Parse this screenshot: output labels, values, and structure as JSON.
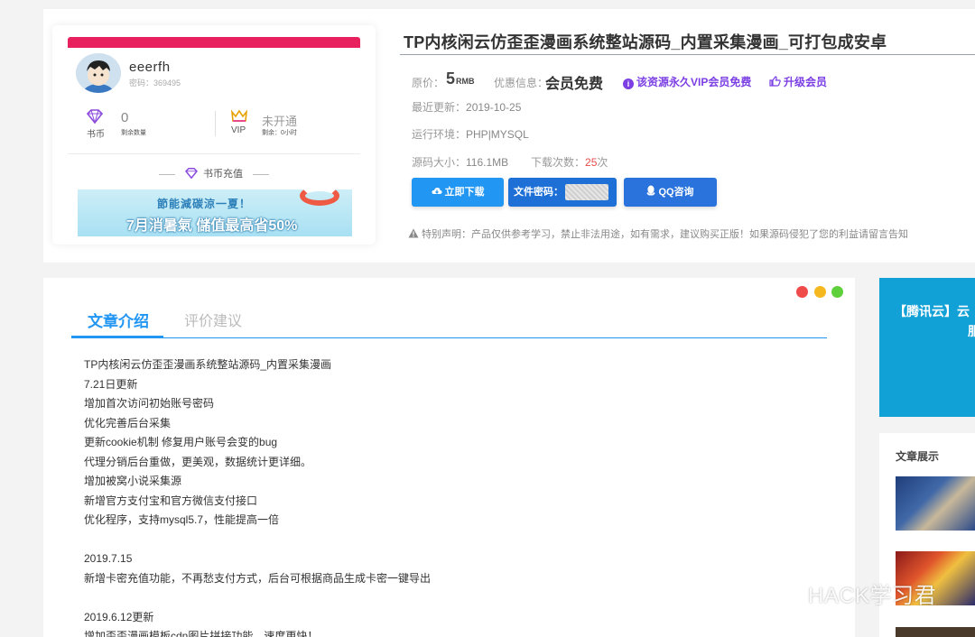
{
  "user_card": {
    "username": "eeerfh",
    "password_line": "密码：369495",
    "coins_label": "书币",
    "coins_value": "0",
    "coins_sub": "剩余数量",
    "vip_label": "VIP",
    "vip_status": "未开通",
    "vip_sub": "剩余：0小时",
    "recharge_label": "书币充值",
    "banner_line1": "節能減碳涼一夏！",
    "banner_line2": "7月消暑氣 儲值最高省50%"
  },
  "product": {
    "title": "TP内核闲云仿歪歪漫画系统整站源码_内置采集漫画_可打包成安卓",
    "price_label": "原价：",
    "price_value": "5",
    "price_unit": "RMB",
    "discount_label": "优惠信息：",
    "discount_value": "会员免费",
    "vip_free_text": "该资源永久VIP会员免费",
    "upgrade_text": "升级会员",
    "updated_label": "最近更新：",
    "updated_value": "2019-10-25",
    "env_label": "运行环境：",
    "env_value": "PHP|MYSQL",
    "size_label": "源码大小：",
    "size_value": "116.1MB",
    "downloads_label": "下载次数：",
    "downloads_value": "25",
    "downloads_unit": "次",
    "btn_download": "立即下载",
    "btn_code": "文件密码：",
    "btn_qq": "QQ咨询",
    "disclaimer": "特别声明：产品仅供参考学习，禁止非法用途，如有需求，建议购买正版！如果源码侵犯了您的利益请留言告知"
  },
  "article": {
    "tab_active": "文章介绍",
    "tab_other": "评价建议",
    "lines": [
      "TP内核闲云仿歪歪漫画系统整站源码_内置采集漫画",
      "7.21日更新",
      "增加首次访问初始账号密码",
      "优化完善后台采集",
      "更新cookie机制 修复用户账号会变的bug",
      "代理分销后台重做，更美观，数据统计更详细。",
      "增加被窝小说采集源",
      "新增官方支付宝和官方微信支付接口",
      "优化程序，支持mysql5.7，性能提高一倍",
      "",
      "2019.7.15",
      "新增卡密充值功能，不再愁支付方式，后台可根据商品生成卡密一键导出",
      "",
      "2019.6.12更新",
      "增加歪歪漫画模板cdn图片拼接功能，速度更快！"
    ],
    "dot_colors": [
      "#f04b4b",
      "#f5b81e",
      "#5fd03c"
    ]
  },
  "sidebar": {
    "ad_text": "【腾讯云】云",
    "ad_text2": "服",
    "articles_header": "文章展示"
  },
  "watermark": "HACK学习君",
  "colors": {
    "accent": "#2196f3",
    "vip_purple": "#7b3fe4",
    "card_bar": "#e8215e"
  }
}
